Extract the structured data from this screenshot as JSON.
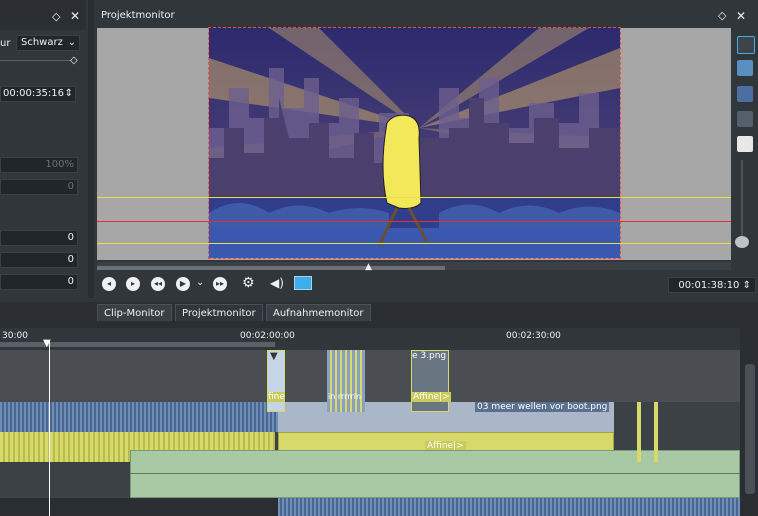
{
  "left_panel": {
    "color_label": "ur",
    "color_value": "Schwarz",
    "timecode": "00:00:35:16",
    "percent": "100%",
    "values": [
      "0",
      "0",
      "0",
      "0"
    ]
  },
  "monitor": {
    "title": "Projektmonitor",
    "timecode": "00:01:38:10",
    "controls": [
      "prev-marker-icon",
      "next-marker-icon",
      "rewind-icon",
      "play-icon",
      "forward-icon",
      "settings-icon",
      "volume-icon",
      "fullscreen-icon"
    ]
  },
  "tabs": [
    "Clip-Monitor",
    "Projektmonitor",
    "Aufnahmemonitor"
  ],
  "timeline": {
    "ticks": [
      "30:00",
      "00:02:00:00",
      "00:02:30:00"
    ],
    "clips": {
      "clip1": "fine",
      "clip2": "in rrrrrin",
      "clip3_name": "e 3.png",
      "clip3_effect": "Affine|>",
      "clip4_name": "03 meer wellen vor boot.png",
      "clip4_effect": "Affine|>"
    }
  },
  "colors": {
    "accent": "#3daee9",
    "clip_green": "#a9c9a4",
    "clip_yellow": "#d7d96a",
    "video_bg": "#3a2f68"
  }
}
